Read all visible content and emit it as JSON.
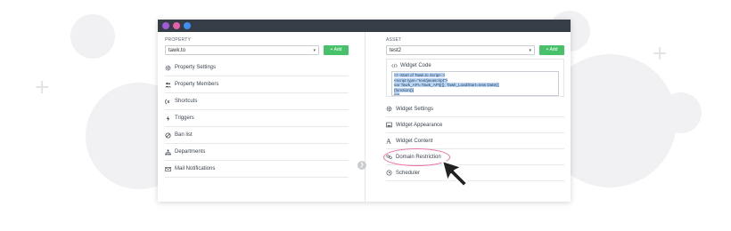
{
  "left": {
    "label": "PROPERTY",
    "select_value": "tawk.to",
    "add_label": "+ Add",
    "items": [
      {
        "label": "Property Settings",
        "icon": "gear-icon"
      },
      {
        "label": "Property Members",
        "icon": "users-icon"
      },
      {
        "label": "Shortcuts",
        "icon": "shortcut-icon"
      },
      {
        "label": "Triggers",
        "icon": "lightning-icon"
      },
      {
        "label": "Ban list",
        "icon": "ban-icon"
      },
      {
        "label": "Departments",
        "icon": "hierarchy-icon"
      },
      {
        "label": "Mail Notifications",
        "icon": "mail-icon"
      }
    ]
  },
  "right": {
    "label": "ASSET",
    "select_value": "test2",
    "add_label": "+ Add",
    "widget_code": {
      "title": "Widget Code",
      "lines": [
        "<!--Start of Tawk.to Script-->",
        "<script type=\"text/javascript\">",
        "var Tawk_API=Tawk_API||{}, Tawk_LoadStart=new Date();",
        "(function(){",
        "var"
      ]
    },
    "items": [
      {
        "label": "Widget Settings",
        "icon": "gear-icon"
      },
      {
        "label": "Widget Appearance",
        "icon": "image-icon"
      },
      {
        "label": "Widget Content",
        "icon": "font-icon"
      },
      {
        "label": "Domain Restriction",
        "icon": "link-icon"
      },
      {
        "label": "Scheduler",
        "icon": "clock-icon"
      }
    ]
  },
  "colors": {
    "titlebar": "#353d47",
    "dot1": "#a35ad6",
    "dot2": "#e75fa6",
    "dot3": "#3f8ff0",
    "add_button": "#47c26b",
    "highlight": "#ee6fa6"
  },
  "arrow_icon": "chevron-right-icon"
}
